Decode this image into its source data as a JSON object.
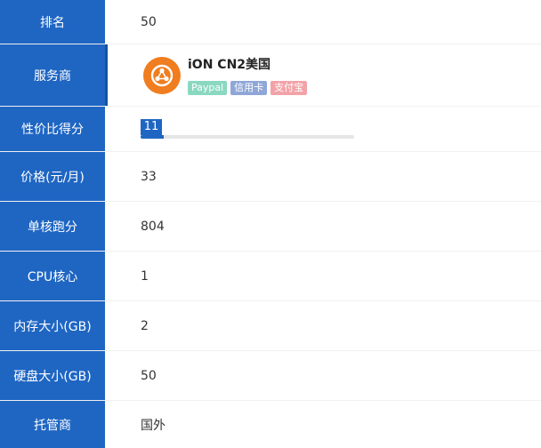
{
  "rows": {
    "rank": {
      "label": "排名",
      "value": "50"
    },
    "provider": {
      "label": "服务商",
      "name": "iON CN2美国",
      "tags": [
        "Paypal",
        "信用卡",
        "支付宝"
      ],
      "logo_icon": "provider-logo-icon"
    },
    "score": {
      "label": "性价比得分",
      "value": "11",
      "bar_percent": 11
    },
    "price": {
      "label": "价格(元/月)",
      "value": "33"
    },
    "single_core": {
      "label": "单核跑分",
      "value": "804"
    },
    "cpu": {
      "label": "CPU核心",
      "value": "1"
    },
    "ram": {
      "label": "内存大小(GB)",
      "value": "2"
    },
    "disk": {
      "label": "硬盘大小(GB)",
      "value": "50"
    },
    "hosting": {
      "label": "托管商",
      "value": "国外"
    }
  },
  "colors": {
    "label_bg": "#1f66c3",
    "logo_orange": "#f07d1f",
    "tag_paypal": "#8ad8c0",
    "tag_card": "#8fa7d8",
    "tag_alipay": "#f2a3a8"
  }
}
